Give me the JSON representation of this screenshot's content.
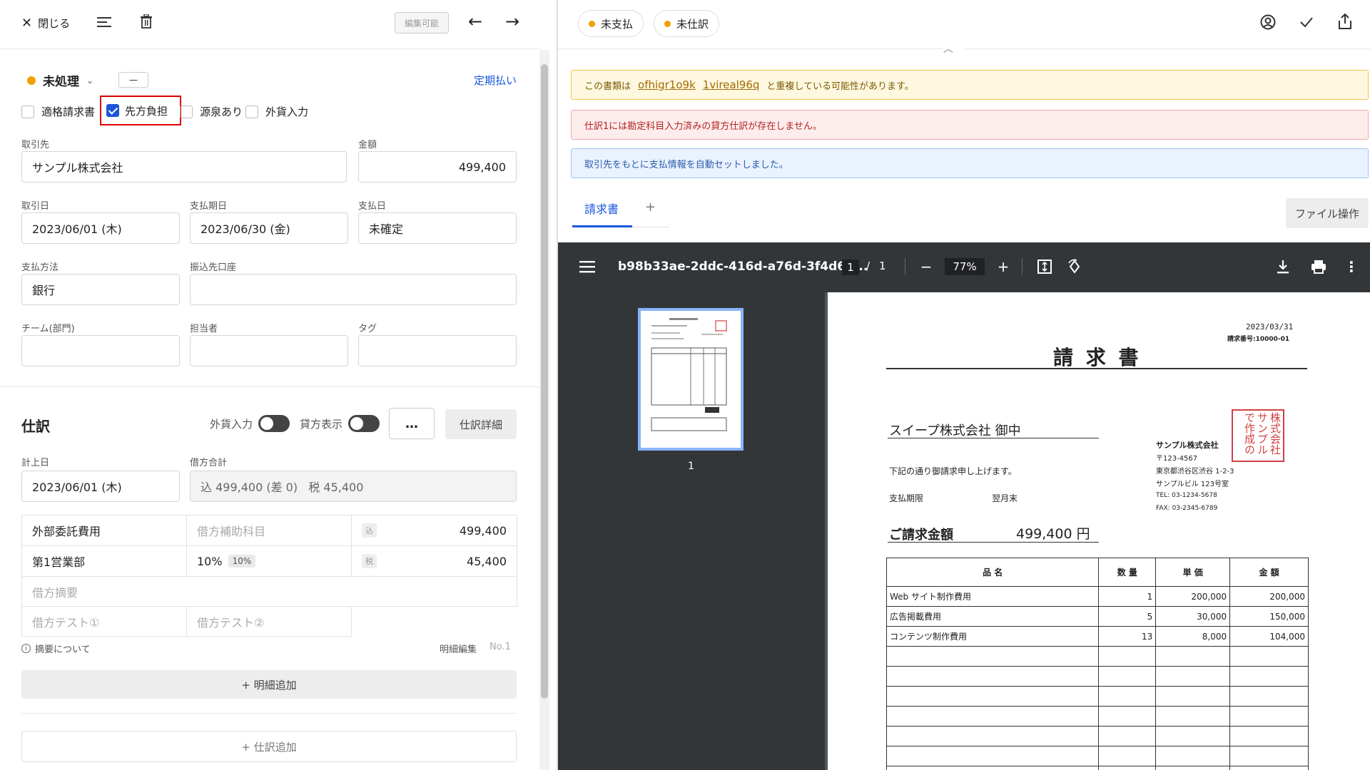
{
  "header": {
    "close_label": "閉じる",
    "edit_badge": "編集可能"
  },
  "status": {
    "label": "未処理",
    "dash": "—",
    "periodic_link": "定期払い"
  },
  "checkboxes": [
    {
      "label": "適格請求書",
      "checked": false
    },
    {
      "label": "先方負担",
      "checked": true
    },
    {
      "label": "源泉あり",
      "checked": false
    },
    {
      "label": "外貨入力",
      "checked": false
    }
  ],
  "form": {
    "partner_label": "取引先",
    "partner_value": "サンプル株式会社",
    "amount_label": "金額",
    "amount_value": "499,400",
    "trade_date_label": "取引日",
    "trade_date_value": "2023/06/01 (木)",
    "due_date_label": "支払期日",
    "due_date_value": "2023/06/30 (金)",
    "pay_date_label": "支払日",
    "pay_date_value": "未確定",
    "method_label": "支払方法",
    "method_value": "銀行",
    "account_label": "振込先口座",
    "account_value": "",
    "team_label": "チーム(部門)",
    "person_label": "担当者",
    "tag_label": "タグ"
  },
  "journal": {
    "title": "仕訳",
    "fx_label": "外貨入力",
    "credit_label": "貸方表示",
    "more": "…",
    "detail_button": "仕訳詳細",
    "record_date_label": "計上日",
    "record_date_value": "2023/06/01 (木)",
    "debit_total_label": "借方合計",
    "debit_total_value": "込 499,400 (差 0)   税 45,400",
    "row1_account": "外部委託費用",
    "row1_sub_placeholder": "借方補助科目",
    "row1_badge": "込",
    "row1_amount": "499,400",
    "row2_dept": "第1営業部",
    "row2_rate": "10%",
    "row2_rate_badge": "10%",
    "row2_badge": "税",
    "row2_amount": "45,400",
    "memo_placeholder": "借方摘要",
    "test1_placeholder": "借方テスト①",
    "test2_placeholder": "借方テスト②",
    "note": "摘要について",
    "edit_label": "明細編集",
    "no_label": "No.1",
    "add_detail": "+ 明細追加",
    "add_journal": "+ 仕訳追加"
  },
  "right": {
    "pill1": "未支払",
    "pill2": "未仕訳",
    "banner_warn_prefix": "この書類は",
    "banner_warn_link1": "ofhigr1o9k",
    "banner_warn_link2": "1vireal96q",
    "banner_warn_suffix": "と重複している可能性があります。",
    "banner_error": "仕訳1には勘定科目入力済みの貸方仕訳が存在しません。",
    "banner_info": "取引先をもとに支払情報を自動セットしました。",
    "tab_invoice": "請求書",
    "tab_add": "+",
    "file_ops": "ファイル操作"
  },
  "viewer": {
    "filename": "b98b33ae-2ddc-416d-a76d-3f4d62...",
    "page_current": "1",
    "page_sep": "/",
    "page_total": "1",
    "zoom": "77%",
    "thumb_label": "1"
  },
  "invoice": {
    "date": "2023/03/31",
    "number": "請求番号:10000-01",
    "title": "請 求 書",
    "to": "スイープ株式会社 御中",
    "intro": "下記の通り御請求申し上げます。",
    "due_label": "支払期限",
    "due_value": "翌月末",
    "company": "サンプル株式会社",
    "zip": "〒123-4567",
    "addr1": "東京都渋谷区渋谷 1-2-3",
    "addr2": "サンプルビル 123号室",
    "tel": "TEL: 03-1234-5678",
    "fax": "FAX: 03-2345-6789",
    "stamp": "株式会社サンプルで作成の",
    "amount_label": "ご請求金額",
    "amount_value": "499,400 円",
    "headers": [
      "品 名",
      "数 量",
      "単 価",
      "金 額"
    ],
    "rows": [
      [
        "Web サイト制作費用",
        "1",
        "200,000",
        "200,000"
      ],
      [
        "広告掲載費用",
        "5",
        "30,000",
        "150,000"
      ],
      [
        "コンテンツ制作費用",
        "13",
        "8,000",
        "104,000"
      ]
    ]
  }
}
